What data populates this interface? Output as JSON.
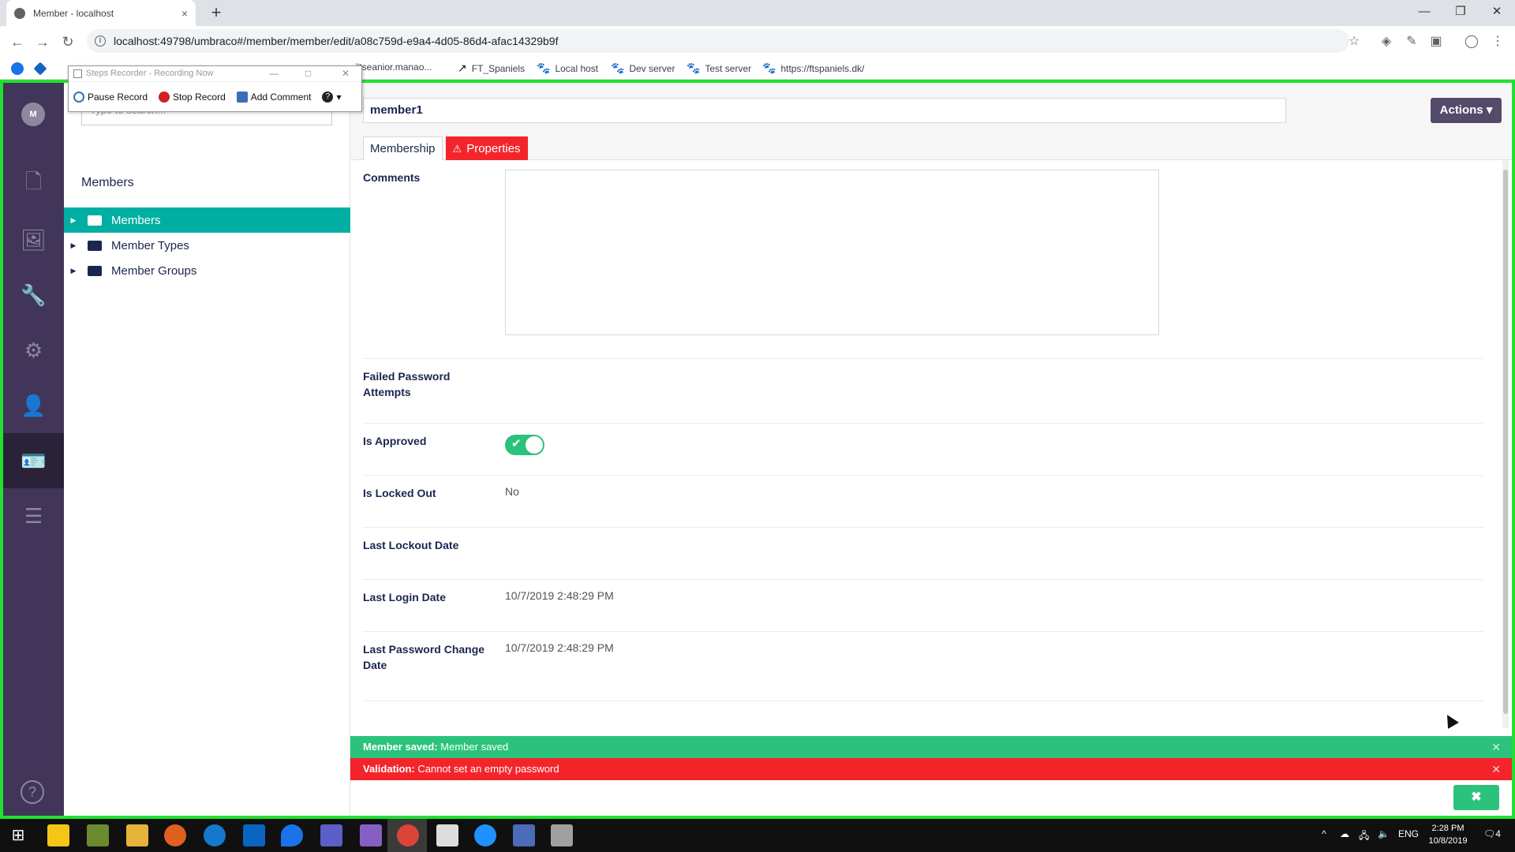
{
  "browser": {
    "tab_title": "Member - localhost",
    "tab_close": "×",
    "new_tab": "+",
    "url": "localhost:49798/umbraco#/member/member/edit/a08c759d-e9a4-4d05-86d4-afac14329b9f",
    "bookmarks": [
      {
        "label": "FT_Spaniels"
      },
      {
        "label": "Local host"
      },
      {
        "label": "Dev server"
      },
      {
        "label": "Test server"
      },
      {
        "label": "https://ftspaniels.dk/"
      }
    ],
    "bookmark_partial": "iltseanior.manao..."
  },
  "steps_recorder": {
    "title": "Steps Recorder - Recording Now",
    "pause_label": "Pause Record",
    "stop_label": "Stop Record",
    "comment_label": "Add Comment"
  },
  "sidebar": {
    "avatar_initial": "M",
    "sections": [
      "content",
      "media",
      "settings",
      "packages",
      "users",
      "members",
      "forms"
    ],
    "active_section": "members"
  },
  "tree": {
    "search_placeholder": "Type to search...",
    "heading": "Members",
    "items": [
      {
        "label": "Members",
        "active": true
      },
      {
        "label": "Member Types",
        "active": false
      },
      {
        "label": "Member Groups",
        "active": false
      }
    ]
  },
  "editor": {
    "name": "member1",
    "actions_label": "Actions ▾",
    "tabs": [
      {
        "label": "Membership"
      },
      {
        "label": "Properties",
        "warning": true
      }
    ],
    "fields": {
      "comments_label": "Comments",
      "failed_attempts_label": "Failed Password Attempts",
      "approved_label": "Is Approved",
      "approved": true,
      "locked_out_label": "Is Locked Out",
      "locked_out_value": "No",
      "last_lockout_label": "Last Lockout Date",
      "last_login_label": "Last Login Date",
      "last_login_value": "10/7/2019 2:48:29 PM",
      "last_pwd_change_label": "Last Password Change Date",
      "last_pwd_change_value": "10/7/2019 2:48:29 PM"
    }
  },
  "notifications": [
    {
      "type": "success",
      "title": "Member saved:",
      "message": "Member saved"
    },
    {
      "type": "error",
      "title": "Validation:",
      "message": "Cannot set an empty password"
    }
  ],
  "taskbar": {
    "lang": "ENG",
    "time": "2:28 PM",
    "date": "10/8/2019",
    "notification_count": "4"
  },
  "colors": {
    "accent_teal": "#00aea2",
    "success": "#2bc37c",
    "error": "#f3252b",
    "nav_bg": "#413659",
    "recording_border": "#22e12e"
  }
}
